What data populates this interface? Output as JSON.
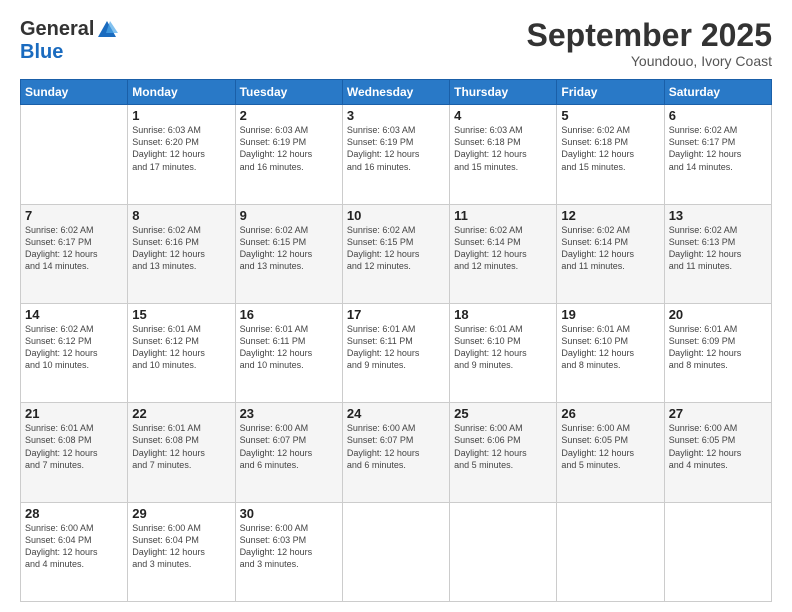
{
  "logo": {
    "general": "General",
    "blue": "Blue"
  },
  "title": "September 2025",
  "location": "Youndouo, Ivory Coast",
  "headers": [
    "Sunday",
    "Monday",
    "Tuesday",
    "Wednesday",
    "Thursday",
    "Friday",
    "Saturday"
  ],
  "weeks": [
    [
      {
        "day": "",
        "info": ""
      },
      {
        "day": "1",
        "info": "Sunrise: 6:03 AM\nSunset: 6:20 PM\nDaylight: 12 hours\nand 17 minutes."
      },
      {
        "day": "2",
        "info": "Sunrise: 6:03 AM\nSunset: 6:19 PM\nDaylight: 12 hours\nand 16 minutes."
      },
      {
        "day": "3",
        "info": "Sunrise: 6:03 AM\nSunset: 6:19 PM\nDaylight: 12 hours\nand 16 minutes."
      },
      {
        "day": "4",
        "info": "Sunrise: 6:03 AM\nSunset: 6:18 PM\nDaylight: 12 hours\nand 15 minutes."
      },
      {
        "day": "5",
        "info": "Sunrise: 6:02 AM\nSunset: 6:18 PM\nDaylight: 12 hours\nand 15 minutes."
      },
      {
        "day": "6",
        "info": "Sunrise: 6:02 AM\nSunset: 6:17 PM\nDaylight: 12 hours\nand 14 minutes."
      }
    ],
    [
      {
        "day": "7",
        "info": "Sunrise: 6:02 AM\nSunset: 6:17 PM\nDaylight: 12 hours\nand 14 minutes."
      },
      {
        "day": "8",
        "info": "Sunrise: 6:02 AM\nSunset: 6:16 PM\nDaylight: 12 hours\nand 13 minutes."
      },
      {
        "day": "9",
        "info": "Sunrise: 6:02 AM\nSunset: 6:15 PM\nDaylight: 12 hours\nand 13 minutes."
      },
      {
        "day": "10",
        "info": "Sunrise: 6:02 AM\nSunset: 6:15 PM\nDaylight: 12 hours\nand 12 minutes."
      },
      {
        "day": "11",
        "info": "Sunrise: 6:02 AM\nSunset: 6:14 PM\nDaylight: 12 hours\nand 12 minutes."
      },
      {
        "day": "12",
        "info": "Sunrise: 6:02 AM\nSunset: 6:14 PM\nDaylight: 12 hours\nand 11 minutes."
      },
      {
        "day": "13",
        "info": "Sunrise: 6:02 AM\nSunset: 6:13 PM\nDaylight: 12 hours\nand 11 minutes."
      }
    ],
    [
      {
        "day": "14",
        "info": "Sunrise: 6:02 AM\nSunset: 6:12 PM\nDaylight: 12 hours\nand 10 minutes."
      },
      {
        "day": "15",
        "info": "Sunrise: 6:01 AM\nSunset: 6:12 PM\nDaylight: 12 hours\nand 10 minutes."
      },
      {
        "day": "16",
        "info": "Sunrise: 6:01 AM\nSunset: 6:11 PM\nDaylight: 12 hours\nand 10 minutes."
      },
      {
        "day": "17",
        "info": "Sunrise: 6:01 AM\nSunset: 6:11 PM\nDaylight: 12 hours\nand 9 minutes."
      },
      {
        "day": "18",
        "info": "Sunrise: 6:01 AM\nSunset: 6:10 PM\nDaylight: 12 hours\nand 9 minutes."
      },
      {
        "day": "19",
        "info": "Sunrise: 6:01 AM\nSunset: 6:10 PM\nDaylight: 12 hours\nand 8 minutes."
      },
      {
        "day": "20",
        "info": "Sunrise: 6:01 AM\nSunset: 6:09 PM\nDaylight: 12 hours\nand 8 minutes."
      }
    ],
    [
      {
        "day": "21",
        "info": "Sunrise: 6:01 AM\nSunset: 6:08 PM\nDaylight: 12 hours\nand 7 minutes."
      },
      {
        "day": "22",
        "info": "Sunrise: 6:01 AM\nSunset: 6:08 PM\nDaylight: 12 hours\nand 7 minutes."
      },
      {
        "day": "23",
        "info": "Sunrise: 6:00 AM\nSunset: 6:07 PM\nDaylight: 12 hours\nand 6 minutes."
      },
      {
        "day": "24",
        "info": "Sunrise: 6:00 AM\nSunset: 6:07 PM\nDaylight: 12 hours\nand 6 minutes."
      },
      {
        "day": "25",
        "info": "Sunrise: 6:00 AM\nSunset: 6:06 PM\nDaylight: 12 hours\nand 5 minutes."
      },
      {
        "day": "26",
        "info": "Sunrise: 6:00 AM\nSunset: 6:05 PM\nDaylight: 12 hours\nand 5 minutes."
      },
      {
        "day": "27",
        "info": "Sunrise: 6:00 AM\nSunset: 6:05 PM\nDaylight: 12 hours\nand 4 minutes."
      }
    ],
    [
      {
        "day": "28",
        "info": "Sunrise: 6:00 AM\nSunset: 6:04 PM\nDaylight: 12 hours\nand 4 minutes."
      },
      {
        "day": "29",
        "info": "Sunrise: 6:00 AM\nSunset: 6:04 PM\nDaylight: 12 hours\nand 3 minutes."
      },
      {
        "day": "30",
        "info": "Sunrise: 6:00 AM\nSunset: 6:03 PM\nDaylight: 12 hours\nand 3 minutes."
      },
      {
        "day": "",
        "info": ""
      },
      {
        "day": "",
        "info": ""
      },
      {
        "day": "",
        "info": ""
      },
      {
        "day": "",
        "info": ""
      }
    ]
  ],
  "rowShading": [
    false,
    true,
    false,
    true,
    false
  ]
}
